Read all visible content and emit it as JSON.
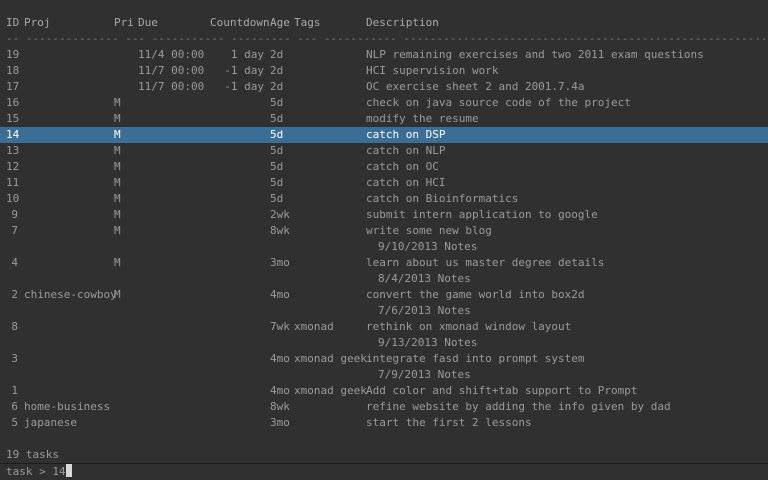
{
  "headers": {
    "id": "ID",
    "proj": "Proj",
    "pri": "Pri",
    "due": "Due",
    "countdown": "Countdown",
    "age": "Age",
    "tags": "Tags",
    "description": "Description"
  },
  "rule": "-- -------------- --- ----------- --------- --- ----------- -----------------------------------------------------------",
  "rows": [
    {
      "id": "19",
      "proj": "",
      "pri": "",
      "due": "11/4 00:00",
      "countdown": "1 day",
      "age": "2d",
      "tags": "",
      "description": "NLP remaining exercises and two 2011 exam questions",
      "annotation": "",
      "selected": false
    },
    {
      "id": "18",
      "proj": "",
      "pri": "",
      "due": "11/7 00:00",
      "countdown": "-1 day",
      "age": "2d",
      "tags": "",
      "description": "HCI supervision work",
      "annotation": "",
      "selected": false
    },
    {
      "id": "17",
      "proj": "",
      "pri": "",
      "due": "11/7 00:00",
      "countdown": "-1 day",
      "age": "2d",
      "tags": "",
      "description": "OC exercise sheet 2 and 2001.7.4a",
      "annotation": "",
      "selected": false
    },
    {
      "id": "16",
      "proj": "",
      "pri": "M",
      "due": "",
      "countdown": "",
      "age": "5d",
      "tags": "",
      "description": "check on java source code of the project",
      "annotation": "",
      "selected": false
    },
    {
      "id": "15",
      "proj": "",
      "pri": "M",
      "due": "",
      "countdown": "",
      "age": "5d",
      "tags": "",
      "description": "modify the resume",
      "annotation": "",
      "selected": false
    },
    {
      "id": "14",
      "proj": "",
      "pri": "M",
      "due": "",
      "countdown": "",
      "age": "5d",
      "tags": "",
      "description": "catch on DSP",
      "annotation": "",
      "selected": true
    },
    {
      "id": "13",
      "proj": "",
      "pri": "M",
      "due": "",
      "countdown": "",
      "age": "5d",
      "tags": "",
      "description": "catch on NLP",
      "annotation": "",
      "selected": false
    },
    {
      "id": "12",
      "proj": "",
      "pri": "M",
      "due": "",
      "countdown": "",
      "age": "5d",
      "tags": "",
      "description": "catch on OC",
      "annotation": "",
      "selected": false
    },
    {
      "id": "11",
      "proj": "",
      "pri": "M",
      "due": "",
      "countdown": "",
      "age": "5d",
      "tags": "",
      "description": "catch on HCI",
      "annotation": "",
      "selected": false
    },
    {
      "id": "10",
      "proj": "",
      "pri": "M",
      "due": "",
      "countdown": "",
      "age": "5d",
      "tags": "",
      "description": "catch on Bioinformatics",
      "annotation": "",
      "selected": false
    },
    {
      "id": "9",
      "proj": "",
      "pri": "M",
      "due": "",
      "countdown": "",
      "age": "2wk",
      "tags": "",
      "description": "submit intern application to google",
      "annotation": "",
      "selected": false
    },
    {
      "id": "7",
      "proj": "",
      "pri": "M",
      "due": "",
      "countdown": "",
      "age": "8wk",
      "tags": "",
      "description": "write some new blog",
      "annotation": "9/10/2013 Notes",
      "selected": false
    },
    {
      "id": "4",
      "proj": "",
      "pri": "M",
      "due": "",
      "countdown": "",
      "age": "3mo",
      "tags": "",
      "description": "learn about us master degree details",
      "annotation": "8/4/2013 Notes",
      "selected": false
    },
    {
      "id": "2",
      "proj": "chinese-cowboy",
      "pri": "M",
      "due": "",
      "countdown": "",
      "age": "4mo",
      "tags": "",
      "description": "convert the game world into box2d",
      "annotation": "7/6/2013 Notes",
      "selected": false
    },
    {
      "id": "8",
      "proj": "",
      "pri": "",
      "due": "",
      "countdown": "",
      "age": "7wk",
      "tags": "xmonad",
      "description": "rethink on xmonad window layout",
      "annotation": "9/13/2013 Notes",
      "selected": false
    },
    {
      "id": "3",
      "proj": "",
      "pri": "",
      "due": "",
      "countdown": "",
      "age": "4mo",
      "tags": "xmonad geek",
      "description": "integrate fasd into prompt system",
      "annotation": "7/9/2013 Notes",
      "selected": false
    },
    {
      "id": "1",
      "proj": "",
      "pri": "",
      "due": "",
      "countdown": "",
      "age": "4mo",
      "tags": "xmonad geek",
      "description": "Add color and shift+tab support to Prompt",
      "annotation": "",
      "selected": false
    },
    {
      "id": "6",
      "proj": "home-business",
      "pri": "",
      "due": "",
      "countdown": "",
      "age": "8wk",
      "tags": "",
      "description": "refine website by adding the info given by dad",
      "annotation": "",
      "selected": false
    },
    {
      "id": "5",
      "proj": "japanese",
      "pri": "",
      "due": "",
      "countdown": "",
      "age": "3mo",
      "tags": "",
      "description": "start the first 2 lessons",
      "annotation": "",
      "selected": false
    }
  ],
  "summary": "19 tasks",
  "prompt": {
    "text": "task > ",
    "input": "14"
  },
  "colors": {
    "background": "#303030",
    "foreground": "#9a9a9a",
    "selection": "#3b6e96",
    "selection_text": "#ffffff"
  }
}
